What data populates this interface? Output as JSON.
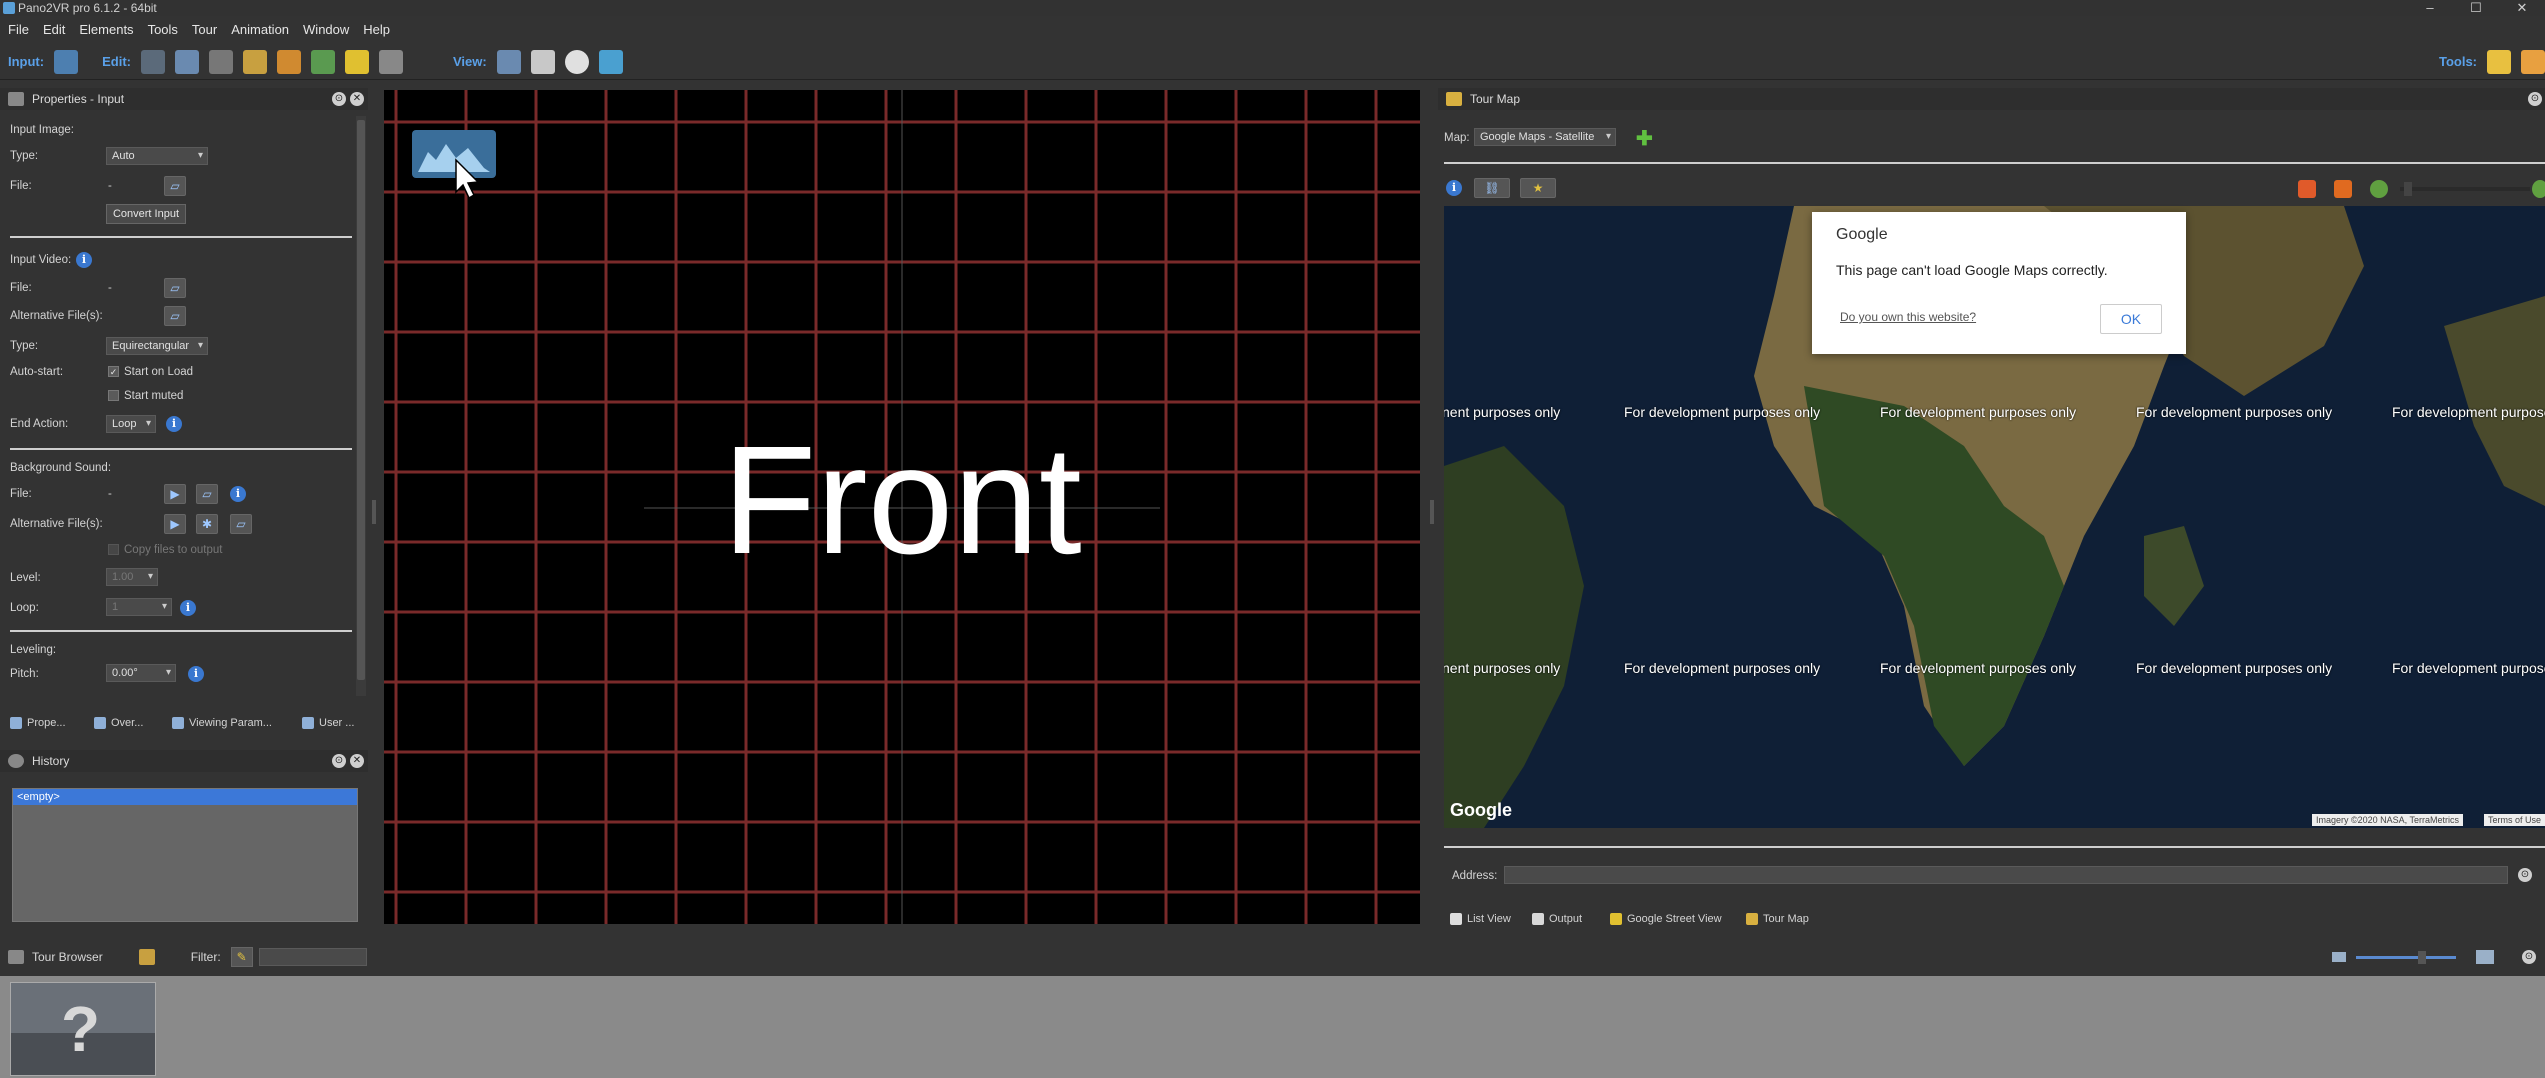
{
  "window": {
    "title": "Pano2VR pro 6.1.2 - 64bit",
    "minimize": "–",
    "maximize": "☐",
    "close": "✕"
  },
  "menu": [
    "File",
    "Edit",
    "Elements",
    "Tools",
    "Tour",
    "Animation",
    "Window",
    "Help"
  ],
  "toolbar": {
    "input_label": "Input:",
    "edit_label": "Edit:",
    "view_label": "View:",
    "tools_label": "Tools:"
  },
  "properties": {
    "title": "Properties - Input",
    "input_image_heading": "Input Image:",
    "type_label": "Type:",
    "type_value": "Auto",
    "file_label": "File:",
    "file_value": "-",
    "convert_button": "Convert Input",
    "input_video_heading": "Input Video:",
    "video_file_label": "File:",
    "video_file_value": "-",
    "alt_files_label": "Alternative File(s):",
    "video_type_label": "Type:",
    "video_type_value": "Equirectangular",
    "autostart_label": "Auto-start:",
    "start_on_load": "Start on Load",
    "start_on_load_checked": true,
    "start_muted": "Start muted",
    "start_muted_checked": false,
    "end_action_label": "End Action:",
    "end_action_value": "Loop",
    "bg_sound_heading": "Background Sound:",
    "sound_file_label": "File:",
    "sound_file_value": "-",
    "sound_alt_label": "Alternative File(s):",
    "copy_files": "Copy files to output",
    "level_label": "Level:",
    "level_value": "1.00",
    "loop_label": "Loop:",
    "loop_value": "1",
    "leveling_heading": "Leveling:",
    "pitch_label": "Pitch:",
    "pitch_value": "0.00°"
  },
  "left_tabs": [
    "Prope...",
    "Over...",
    "Viewing Param...",
    "User ..."
  ],
  "history": {
    "title": "History",
    "item": "<empty>"
  },
  "viewer": {
    "face_label": "Front"
  },
  "tour_map": {
    "title": "Tour Map",
    "map_label": "Map:",
    "map_value": "Google Maps - Satellite",
    "watermark": "For development purposes only",
    "watermark_partial": "nent purposes only",
    "google_logo": "Google",
    "imagery_credit": "Imagery ©2020 NASA, TerraMetrics",
    "terms": "Terms of Use",
    "dialog": {
      "brand": "Google",
      "message": "This page can't load Google Maps correctly.",
      "link": "Do you own this website?",
      "ok": "OK"
    },
    "address_label": "Address:",
    "address_value": ""
  },
  "right_tabs": [
    "List View",
    "Output",
    "Google Street View",
    "Tour Map"
  ],
  "tour_browser": {
    "title": "Tour Browser",
    "filter_label": "Filter:",
    "filter_value": ""
  }
}
